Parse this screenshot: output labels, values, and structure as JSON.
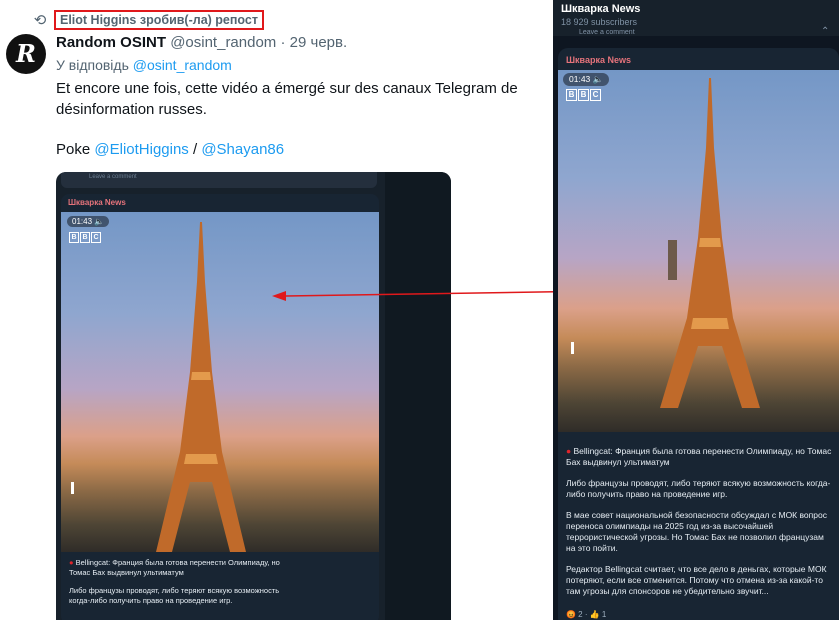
{
  "tweet": {
    "reposter_label": "Eliot Higgins зробив(-ла) репост",
    "author_name": "Random OSINT",
    "author_handle": "@osint_random",
    "date": "· 29 черв.",
    "reply_prefix": "У відповідь",
    "reply_to": "@osint_random",
    "body": "Et encore une fois, cette vidéo a émergé sur des canaux Telegram de désinformation russes.",
    "poke_prefix": "Poke",
    "mention_1": "@EliotHiggins",
    "separator": "/",
    "mention_2": "@Shayan86",
    "avatar_letter": "R"
  },
  "embedded_post": {
    "author": "Шкварка News",
    "video_time": "01:43",
    "video_logo": [
      "B",
      "B",
      "C"
    ],
    "text_lines": [
      "Bellingcat: Франция была готова перенести Олимпиаду, но",
      "Томас Бах выдвинул ультиматум",
      "Либо французы проводят, либо теряют всякую возможность",
      "когда-либо получить право на проведение игр."
    ],
    "top_bar_text": "Leave a comment"
  },
  "channel": {
    "title": "Шкварка News",
    "subscribers": "18 929 subscribers",
    "leave_comment": "Leave a comment",
    "post_author": "Шкварка News",
    "video_time": "01:43",
    "video_logo": [
      "B",
      "B",
      "C"
    ],
    "paragraphs": [
      "Bellingcat: Франция была готова перенести Олимпиаду, но Томас Бах выдвинул ультиматум",
      "Либо французы проводят, либо теряют всякую возможность когда-либо получить право на проведение игр.",
      "В мае совет национальной безопасности обсуждал с МОК вопрос переноса олимпиады на 2025 год из-за высочайшей террористической угрозы. Но Томас Бах не позволил французам на это пойти.",
      "Редактор Bellingcat считает, что все дело в деньгах, которые МОК потеряют, если все отменится. Потому что отмена из-за какой-то там угрозы для спонсоров не убедительно звучит..."
    ],
    "reactions": "😡 2 · 👍 1"
  },
  "colors": {
    "highlight_box": "#e0181b",
    "arrow": "#e0181b",
    "link": "#1d9bf0",
    "telegram_bg": "#0e1621",
    "post_author": "#e5737b"
  },
  "icons": [
    "retweet-icon",
    "sound-icon",
    "arrow"
  ]
}
